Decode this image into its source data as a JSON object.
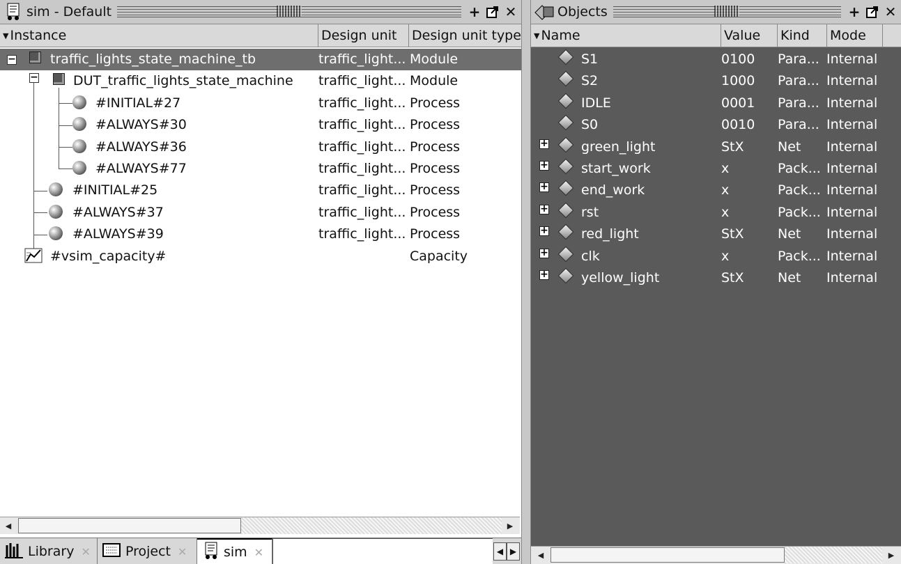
{
  "left_panel": {
    "title": "sim - Default",
    "columns": [
      "Instance",
      "Design unit",
      "Design unit type"
    ],
    "rows": [
      {
        "name": "traffic_lights_state_machine_tb",
        "unit": "traffic_light...",
        "type": "Module"
      },
      {
        "name": "DUT_traffic_lights_state_machine",
        "unit": "traffic_light...",
        "type": "Module"
      },
      {
        "name": "#INITIAL#27",
        "unit": "traffic_light...",
        "type": "Process"
      },
      {
        "name": "#ALWAYS#30",
        "unit": "traffic_light...",
        "type": "Process"
      },
      {
        "name": "#ALWAYS#36",
        "unit": "traffic_light...",
        "type": "Process"
      },
      {
        "name": "#ALWAYS#77",
        "unit": "traffic_light...",
        "type": "Process"
      },
      {
        "name": "#INITIAL#25",
        "unit": "traffic_light...",
        "type": "Process"
      },
      {
        "name": "#ALWAYS#37",
        "unit": "traffic_light...",
        "type": "Process"
      },
      {
        "name": "#ALWAYS#39",
        "unit": "traffic_light...",
        "type": "Process"
      },
      {
        "name": "#vsim_capacity#",
        "unit": "",
        "type": "Capacity"
      }
    ]
  },
  "right_panel": {
    "title": "Objects",
    "columns": [
      "Name",
      "Value",
      "Kind",
      "Mode"
    ],
    "rows": [
      {
        "name": "S1",
        "value": "0100",
        "kind": "Para...",
        "mode": "Internal",
        "expandable": false
      },
      {
        "name": "S2",
        "value": "1000",
        "kind": "Para...",
        "mode": "Internal",
        "expandable": false
      },
      {
        "name": "IDLE",
        "value": "0001",
        "kind": "Para...",
        "mode": "Internal",
        "expandable": false
      },
      {
        "name": "S0",
        "value": "0010",
        "kind": "Para...",
        "mode": "Internal",
        "expandable": false
      },
      {
        "name": "green_light",
        "value": "StX",
        "kind": "Net",
        "mode": "Internal",
        "expandable": true
      },
      {
        "name": "start_work",
        "value": "x",
        "kind": "Pack...",
        "mode": "Internal",
        "expandable": true
      },
      {
        "name": "end_work",
        "value": "x",
        "kind": "Pack...",
        "mode": "Internal",
        "expandable": true
      },
      {
        "name": "rst",
        "value": "x",
        "kind": "Pack...",
        "mode": "Internal",
        "expandable": true
      },
      {
        "name": "red_light",
        "value": "StX",
        "kind": "Net",
        "mode": "Internal",
        "expandable": true
      },
      {
        "name": "clk",
        "value": "x",
        "kind": "Pack...",
        "mode": "Internal",
        "expandable": true
      },
      {
        "name": "yellow_light",
        "value": "StX",
        "kind": "Net",
        "mode": "Internal",
        "expandable": true
      }
    ]
  },
  "tabs": [
    {
      "label": "Library",
      "icon": "library-icon",
      "active": false
    },
    {
      "label": "Project",
      "icon": "project-icon",
      "active": false
    },
    {
      "label": "sim",
      "icon": "sim-icon",
      "active": true
    }
  ],
  "window_buttons": {
    "dock": "+",
    "undock": "⧉",
    "close": "✕"
  }
}
